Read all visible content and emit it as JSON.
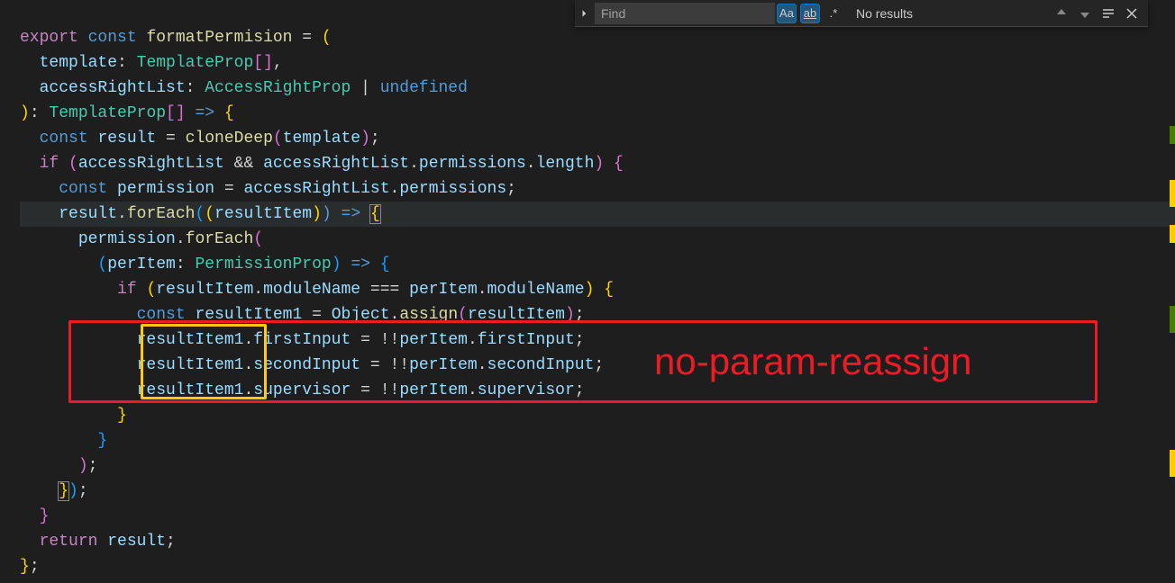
{
  "find": {
    "placeholder": "Find",
    "case_label": "Aa",
    "word_label": "ab",
    "regex_label": ".*",
    "results": "No results"
  },
  "code": {
    "l1": {
      "export": "export",
      "const": "const",
      "fn": "formatPermision",
      "eq": " = ",
      "paren": "("
    },
    "l2": {
      "indent": "  ",
      "param": "template",
      "colon": ": ",
      "type": "TemplateProp",
      "arr": "[],",
      "comma": ""
    },
    "l3": {
      "indent": "  ",
      "param": "accessRightList",
      "colon": ": ",
      "type": "AccessRightProp",
      "bar": " | ",
      "undef": "undefined"
    },
    "l4": {
      "close": ")",
      "colon": ": ",
      "type": "TemplateProp",
      "arr": "[]",
      "arrow": " => ",
      "brace": "{"
    },
    "l5": {
      "indent": "  ",
      "const": "const",
      "var": "result",
      "eq": " = ",
      "fn": "cloneDeep",
      "open": "(",
      "arg": "template",
      "close": ");"
    },
    "l6": {
      "indent": "  ",
      "if": "if",
      "open": " (",
      "v1": "accessRightList",
      "and": " && ",
      "v2": "accessRightList",
      "dot1": ".",
      "p1": "permissions",
      "dot2": ".",
      "p2": "length",
      "close": ") {"
    },
    "l7": {
      "indent": "    ",
      "const": "const",
      "var": "permission",
      "eq": " = ",
      "src": "accessRightList",
      "dot": ".",
      "prop": "permissions",
      "semi": ";"
    },
    "l8": {
      "indent": "    ",
      "obj": "result",
      "dot": ".",
      "fn": "forEach",
      "open": "((",
      "param": "resultItem",
      "close": ") => ",
      "brace": "{"
    },
    "l9": {
      "indent": "      ",
      "obj": "permission",
      "dot": ".",
      "fn": "forEach",
      "open": "("
    },
    "l10": {
      "indent": "        ",
      "open": "(",
      "param": "perItem",
      "colon": ": ",
      "type": "PermissionProp",
      "close": ") => {"
    },
    "l11": {
      "indent": "          ",
      "if": "if",
      "open": " (",
      "v1": "resultItem",
      "dot1": ".",
      "p1": "moduleName",
      "eq": " === ",
      "v2": "perItem",
      "dot2": ".",
      "p2": "moduleName",
      "close": ") {"
    },
    "l12": {
      "indent": "            ",
      "const": "const",
      "var": "resultItem1",
      "eq": " = ",
      "obj": "Object",
      "dot": ".",
      "fn": "assign",
      "open": "(",
      "arg": "resultItem",
      "close": ");"
    },
    "l13": {
      "indent": "            ",
      "var": "resultItem1",
      "dot": ".",
      "prop": "firstInput",
      "eq": " = !!",
      "src": "perItem",
      "dot2": ".",
      "prop2": "firstInput",
      "semi": ";"
    },
    "l14": {
      "indent": "            ",
      "var": "resultItem1",
      "dot": ".",
      "prop": "secondInput",
      "eq": " = !!",
      "src": "perItem",
      "dot2": ".",
      "prop2": "secondInput",
      "semi": ";"
    },
    "l15": {
      "indent": "            ",
      "var": "resultItem1",
      "dot": ".",
      "prop": "supervisor",
      "eq": " = !!",
      "src": "perItem",
      "dot2": ".",
      "prop2": "supervisor",
      "semi": ";"
    },
    "l16": {
      "indent": "          ",
      "brace": "}"
    },
    "l17": {
      "indent": "        ",
      "brace": "}"
    },
    "l18": {
      "indent": "      ",
      "close": ");"
    },
    "l19": {
      "indent": "    ",
      "close": "});"
    },
    "l20": {
      "indent": "  ",
      "brace": "}"
    },
    "l21": {
      "indent": "  ",
      "return": "return",
      "var": " result",
      "semi": ";"
    },
    "l22": {
      "close": "};"
    }
  },
  "annotation": {
    "label": "no-param-reassign"
  }
}
